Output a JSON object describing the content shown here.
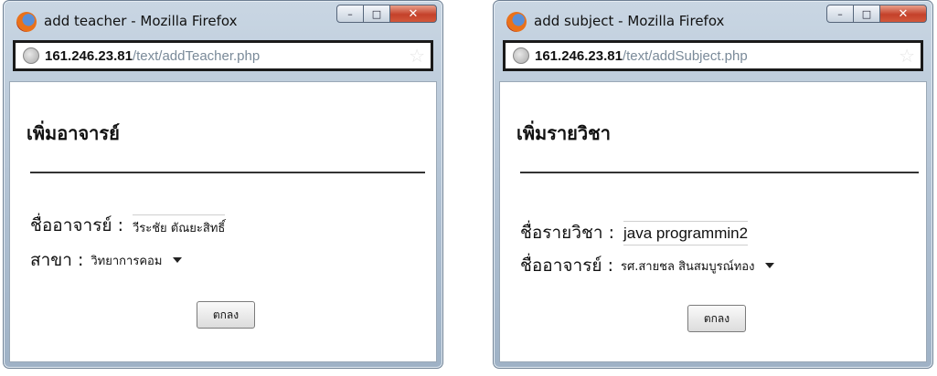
{
  "windows": [
    {
      "title": "add teacher - Mozilla Firefox",
      "url_host": "161.246.23.81",
      "url_path": "/text/addTeacher.php",
      "heading": "เพิ่มอาจารย์",
      "field1_label": "ชื่ออาจารย์ :",
      "field1_value": "วีระชัย ตัณยะสิทธิ์",
      "field2_label": "สาขา :",
      "field2_value": "วิทยาการคอม",
      "button": "ตกลง"
    },
    {
      "title": "add subject - Mozilla Firefox",
      "url_host": "161.246.23.81",
      "url_path": "/text/addSubject.php",
      "heading": "เพิ่มรายวิชา",
      "field1_label": "ชื่อรายวิชา :",
      "field1_value": "java programmin2",
      "field2_label": "ชื่ออาจารย์ :",
      "field2_value": "รศ.สายชล สินสมบูรณ์ทอง",
      "button": "ตกลง"
    }
  ],
  "icons": {
    "window_icon": "firefox-logo-icon",
    "site_icon": "globe-icon",
    "bookmark_icon": "star-icon",
    "dropdown_icon": "chevron-down-icon"
  }
}
